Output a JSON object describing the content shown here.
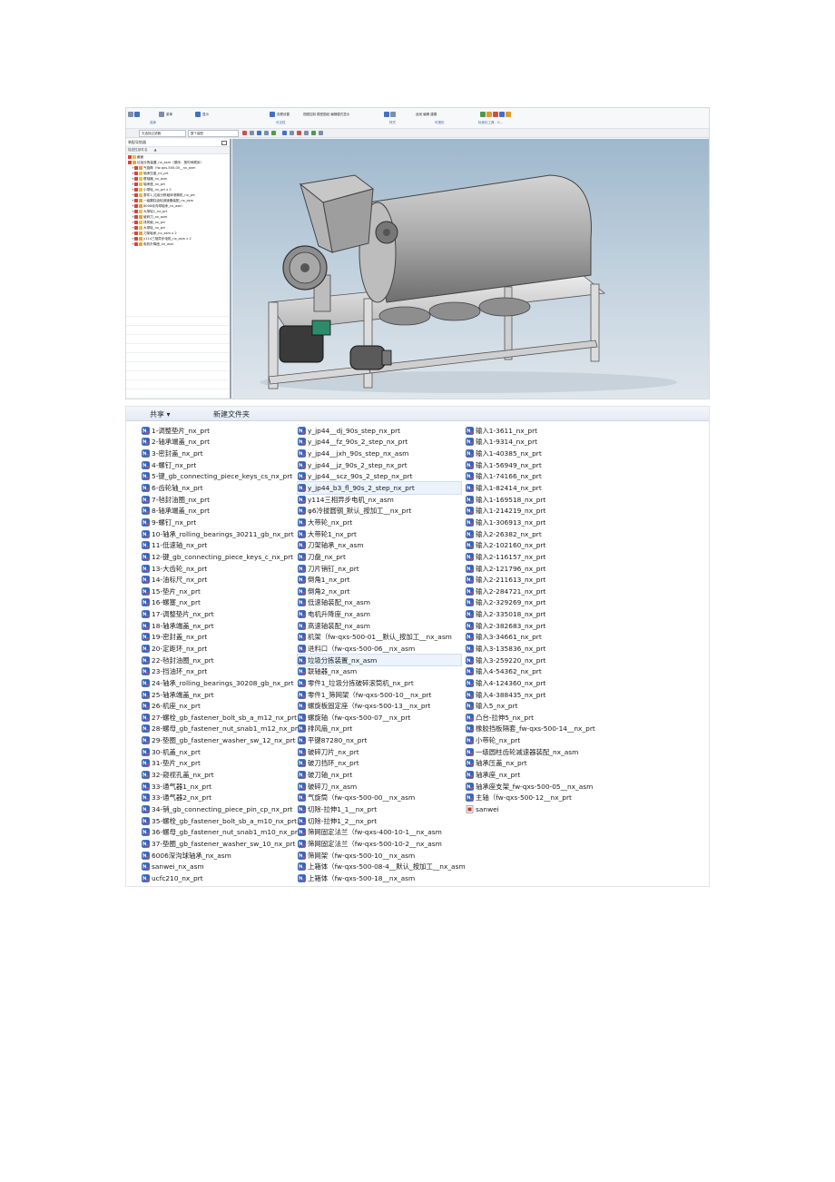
{
  "nx": {
    "ribbon": {
      "commands": [
        {
          "label": "菜单",
          "icon": "menu-icon"
        },
        {
          "label": "选择过滤器",
          "icon": "filter-icon"
        },
        {
          "label": "显示",
          "icon": "display-icon"
        },
        {
          "label": "查看设置",
          "icon": "view-icon"
        },
        {
          "label": "视图控制 模型图纸 编辑模式显示",
          "icon": "view-tools-icon"
        },
        {
          "label": "适用 编辑 建模",
          "icon": "edit-icon"
        }
      ],
      "groups": [
        "选择",
        "可见性",
        "样式",
        "可视化",
        "标准化工具 - G..."
      ]
    },
    "toolbar2": {
      "filter_value": "无选择过滤器",
      "scope_value": "整个装配"
    },
    "navigator": {
      "title": "装配导航器",
      "column_header": "描述性部件名",
      "rows": [
        {
          "label": "截面",
          "type": "folder",
          "indent": 0
        },
        {
          "label": "垃圾分拣装置_nx_asm（顺序：按时间顺序）",
          "type": "asm",
          "indent": 0
        },
        {
          "label": "气旋筒（fw-qxs-500-00__nx_asm",
          "type": "asm",
          "indent": 1
        },
        {
          "label": "轴承压盖_nx_prt",
          "type": "prt",
          "indent": 1
        },
        {
          "label": "联轴器_nx_asm",
          "type": "prt",
          "indent": 1
        },
        {
          "label": "轴承座_nx_prt",
          "type": "prt",
          "indent": 1
        },
        {
          "label": "小带轮_nx_prt x 2",
          "type": "prt",
          "indent": 1
        },
        {
          "label": "零件1_垃圾分拣破碎滚筒机_nx_prt",
          "type": "prt",
          "indent": 1
        },
        {
          "label": "一级圆柱齿轮减速器装配_nx_asm",
          "type": "asm",
          "indent": 1
        },
        {
          "label": "6006深沟球轴承_nx_asm",
          "type": "asm",
          "indent": 1
        },
        {
          "label": "大带轮1_nx_prt",
          "type": "prt",
          "indent": 1
        },
        {
          "label": "破碎刀_nx_asm",
          "type": "asm",
          "indent": 1
        },
        {
          "label": "排风扇_nx_prt",
          "type": "prt",
          "indent": 1
        },
        {
          "label": "大带轮_nx_prt",
          "type": "prt",
          "indent": 1
        },
        {
          "label": "刀架轴承_nx_asm x 2",
          "type": "asm",
          "indent": 1
        },
        {
          "label": "y114三相异步电机_nx_asm x 2",
          "type": "asm",
          "indent": 1
        },
        {
          "label": "电机升降座_nx_asm",
          "type": "asm",
          "indent": 1
        }
      ]
    }
  },
  "explorer": {
    "commands": [
      "共享 ▾",
      "新建文件夹"
    ],
    "columns": [
      [
        "1-调整垫片_nx_prt",
        "2-轴承端盖_nx_prt",
        "3-密封盖_nx_prt",
        "4-螺钉_nx_prt",
        "5-键_gb_connecting_piece_keys_cs_nx_prt",
        "6-齿轮轴_nx_prt",
        "7-毡封油圈_nx_prt",
        "8-轴承端盖_nx_prt",
        "9-螺钉_nx_prt",
        "10-轴承_rolling_bearings_30211_gb_nx_prt",
        "11-低速轴_nx_prt",
        "12-键_gb_connecting_piece_keys_c_nx_prt",
        "13-大齿轮_nx_prt",
        "14-油标尺_nx_prt",
        "15-垫片_nx_prt",
        "16-螺塞_nx_prt",
        "17-调整垫片_nx_prt",
        "18-轴承端盖_nx_prt",
        "19-密封盖_nx_prt",
        "20-定距环_nx_prt",
        "22-毡封油圈_nx_prt",
        "23-挡油环_nx_prt",
        "24-轴承_rolling_bearings_30208_gb_nx_prt",
        "25-轴承端盖_nx_prt",
        "26-机座_nx_prt",
        "27-螺栓_gb_fastener_bolt_sb_a_m12_nx_prt",
        "28-螺母_gb_fastener_nut_snab1_m12_nx_prt",
        "29-垫圈_gb_fastener_washer_sw_12_nx_prt",
        "30-机盖_nx_prt",
        "31-垫片_nx_prt",
        "32-窥视孔盖_nx_prt",
        "33-通气器1_nx_prt",
        "33-通气器2_nx_prt",
        "34-销_gb_connecting_piece_pin_cp_nx_prt",
        "35-螺栓_gb_fastener_bolt_sb_a_m10_nx_prt",
        "36-螺母_gb_fastener_nut_snab1_m10_nx_prt",
        "37-垫圈_gb_fastener_washer_sw_10_nx_prt",
        "6006深沟球轴承_nx_asm",
        "sanwei_nx_asm",
        "ucfc210_nx_prt"
      ],
      [
        "y_jp44__dj_90s_step_nx_prt",
        "y_jp44__fz_90s_2_step_nx_prt",
        "y_jp44__jxh_90s_step_nx_asm",
        "y_jp44__jz_90s_2_step_nx_prt",
        "y_jp44__scz_90s_2_step_nx_prt",
        "y_jp44_b3_fl_90s_2_step_nx_prt",
        "y114三相异步电机_nx_asm",
        "φ6冷拔圆钢_默认_按加工__nx_prt",
        "大带轮_nx_prt",
        "大带轮1_nx_prt",
        "刀架轴承_nx_asm",
        "刀盘_nx_prt",
        "刀片销钉_nx_prt",
        "倒角1_nx_prt",
        "倒角2_nx_prt",
        "低速轴装配_nx_asm",
        "电机升降座_nx_asm",
        "高速轴装配_nx_asm",
        "机架（fw-qxs-500-01__默认_按加工__nx_asm",
        "进料口（fw-qxs-500-06__nx_asm",
        "垃圾分拣装置_nx_asm",
        "联轴器_nx_asm",
        "零件1_垃圾分拣破碎滚筒机_nx_prt",
        "零件1_筛网架（fw-qxs-500-10__nx_prt",
        "螺旋板固定座（fw-qxs-500-13__nx_prt",
        "螺旋轴（fw-qxs-500-07__nx_prt",
        "排风扇_nx_prt",
        "平键87280_nx_prt",
        "破碎刀片_nx_prt",
        "破刀挡环_nx_prt",
        "破刀轴_nx_prt",
        "破碎刀_nx_asm",
        "气旋筒（fw-qxs-500-00__nx_asm",
        "切除-拉伸1_1__nx_prt",
        "切除-拉伸1_2__nx_prt",
        "筛网固定法兰（fw-qxs-400-10-1__nx_asm",
        "筛网固定法兰（fw-qxs-500-10-2__nx_asm",
        "筛网架（fw-qxs-500-10__nx_asm",
        "上箱体（fw-qxs-500-08-4__默认_按加工__nx_asm",
        "上箱体（fw-qxs-500-18__nx_asm"
      ],
      [
        "输入1-3611_nx_prt",
        "输入1-9314_nx_prt",
        "输入1-40385_nx_prt",
        "输入1-56949_nx_prt",
        "输入1-74166_nx_prt",
        "输入1-82414_nx_prt",
        "输入1-169518_nx_prt",
        "输入1-214219_nx_prt",
        "输入1-306913_nx_prt",
        "输入2-26382_nx_prt",
        "输入2-102160_nx_prt",
        "输入2-116157_nx_prt",
        "输入2-121796_nx_prt",
        "输入2-211613_nx_prt",
        "输入2-284721_nx_prt",
        "输入2-329269_nx_prt",
        "输入2-335018_nx_prt",
        "输入2-382683_nx_prt",
        "输入3-34661_nx_prt",
        "输入3-135836_nx_prt",
        "输入3-259220_nx_prt",
        "输入4-54362_nx_prt",
        "输入4-124360_nx_prt",
        "输入4-388435_nx_prt",
        "输入5_nx_prt",
        "凸台-拉伸5_nx_prt",
        "橡胶挡板隔套_fw-qxs-500-14__nx_prt",
        "小带轮_nx_prt",
        "一级圆柱齿轮减速器装配_nx_asm",
        "轴承压盖_nx_prt",
        "轴承座_nx_prt",
        "轴承座支架_fw-qxs-500-05__nx_asm",
        "主轴（fw-qxs-500-12__nx_prt",
        "sanwei"
      ]
    ]
  }
}
